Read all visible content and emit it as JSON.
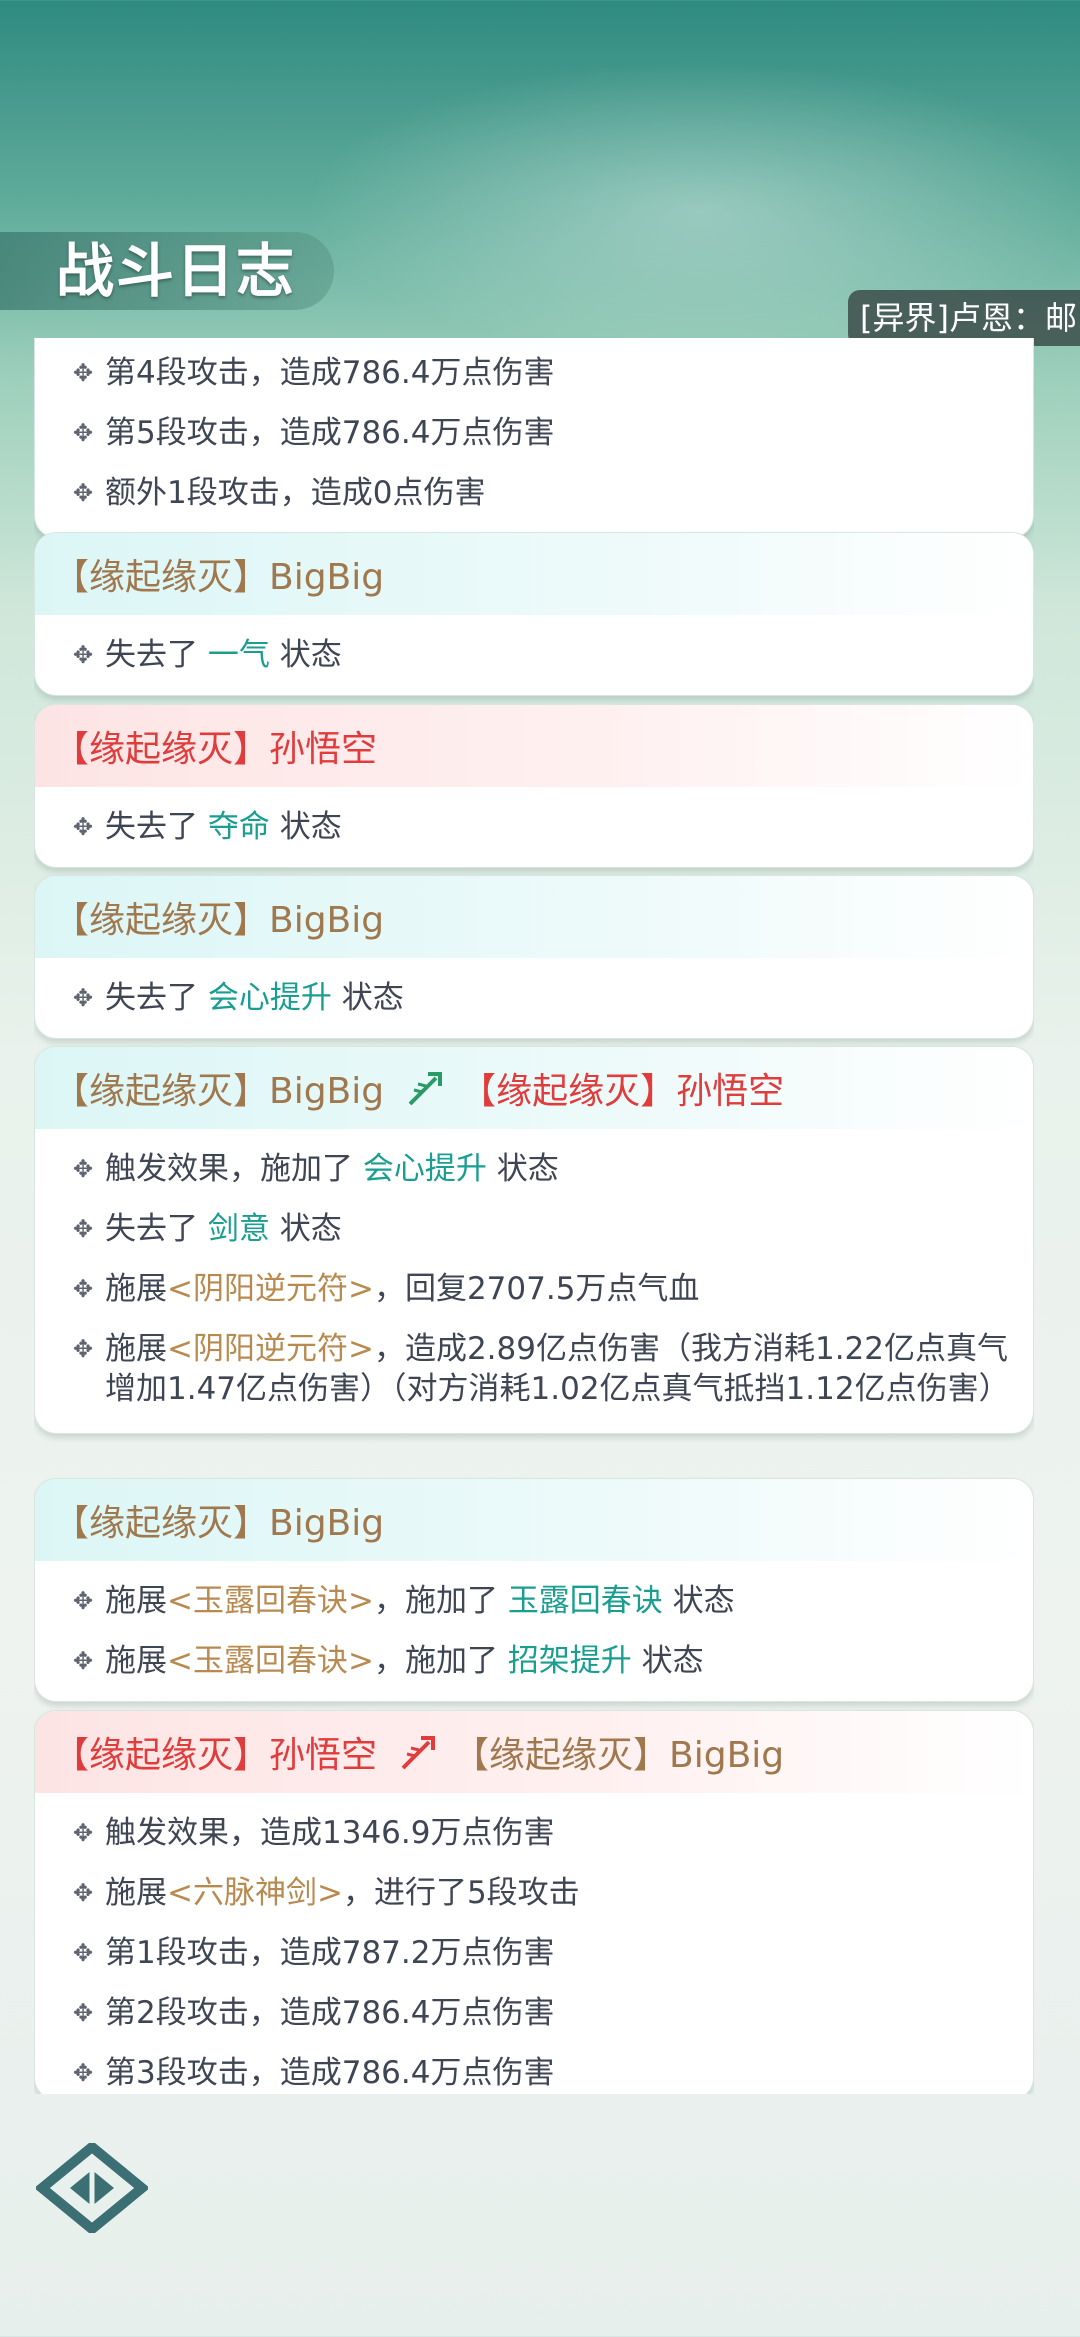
{
  "header": {
    "title": "战斗日志",
    "marquee": "[异界]卢恩：邮"
  },
  "colors": {
    "status": "#1a9e90",
    "skill": "#b88a50",
    "ally_name": "#a0784e",
    "enemy_name": "#e03c3c"
  },
  "cards": {
    "c0": {
      "lines": [
        "第4段攻击，造成786.4万点伤害",
        "第5段攻击，造成786.4万点伤害",
        "额外1段攻击，造成0点伤害"
      ]
    },
    "c1": {
      "actor": "【缘起缘灭】BigBig",
      "lines": [
        {
          "pre": "失去了 ",
          "status": "一气",
          "post": " 状态"
        }
      ]
    },
    "c2": {
      "actor": "【缘起缘灭】孙悟空",
      "lines": [
        {
          "pre": "失去了 ",
          "status": "夺命",
          "post": " 状态"
        }
      ]
    },
    "c3": {
      "actor": "【缘起缘灭】BigBig",
      "lines": [
        {
          "pre": "失去了 ",
          "status": "会心提升",
          "post": " 状态"
        }
      ]
    },
    "c4": {
      "actor": "【缘起缘灭】BigBig",
      "target": "【缘起缘灭】孙悟空",
      "l1": {
        "pre": "触发效果，施加了 ",
        "status": "会心提升",
        "post": " 状态"
      },
      "l2": {
        "pre": "失去了 ",
        "status": "剑意",
        "post": " 状态"
      },
      "l3": {
        "pre": "施展",
        "skill": "<阴阳逆元符>",
        "post": "，回复2707.5万点气血"
      },
      "l4": {
        "pre": "施展",
        "skill": "<阴阳逆元符>",
        "post": "，造成2.89亿点伤害（我方消耗1.22亿点真气增加1.47亿点伤害）（对方消耗1.02亿点真气抵挡1.12亿点伤害）"
      }
    },
    "c5": {
      "actor": "【缘起缘灭】BigBig",
      "l1": {
        "pre": "施展",
        "skill": "<玉露回春诀>",
        "mid": "，施加了 ",
        "status": "玉露回春诀",
        "post": " 状态"
      },
      "l2": {
        "pre": "施展",
        "skill": "<玉露回春诀>",
        "mid": "，施加了 ",
        "status": "招架提升",
        "post": " 状态"
      }
    },
    "c6": {
      "actor": "【缘起缘灭】孙悟空",
      "target": "【缘起缘灭】BigBig",
      "l1": "触发效果，造成1346.9万点伤害",
      "l2": {
        "pre": "施展",
        "skill": "<六脉神剑>",
        "post": "，进行了5段攻击"
      },
      "l3": "第1段攻击，造成787.2万点伤害",
      "l4": "第2段攻击，造成786.4万点伤害",
      "l5": "第3段攻击，造成786.4万点伤害"
    }
  }
}
